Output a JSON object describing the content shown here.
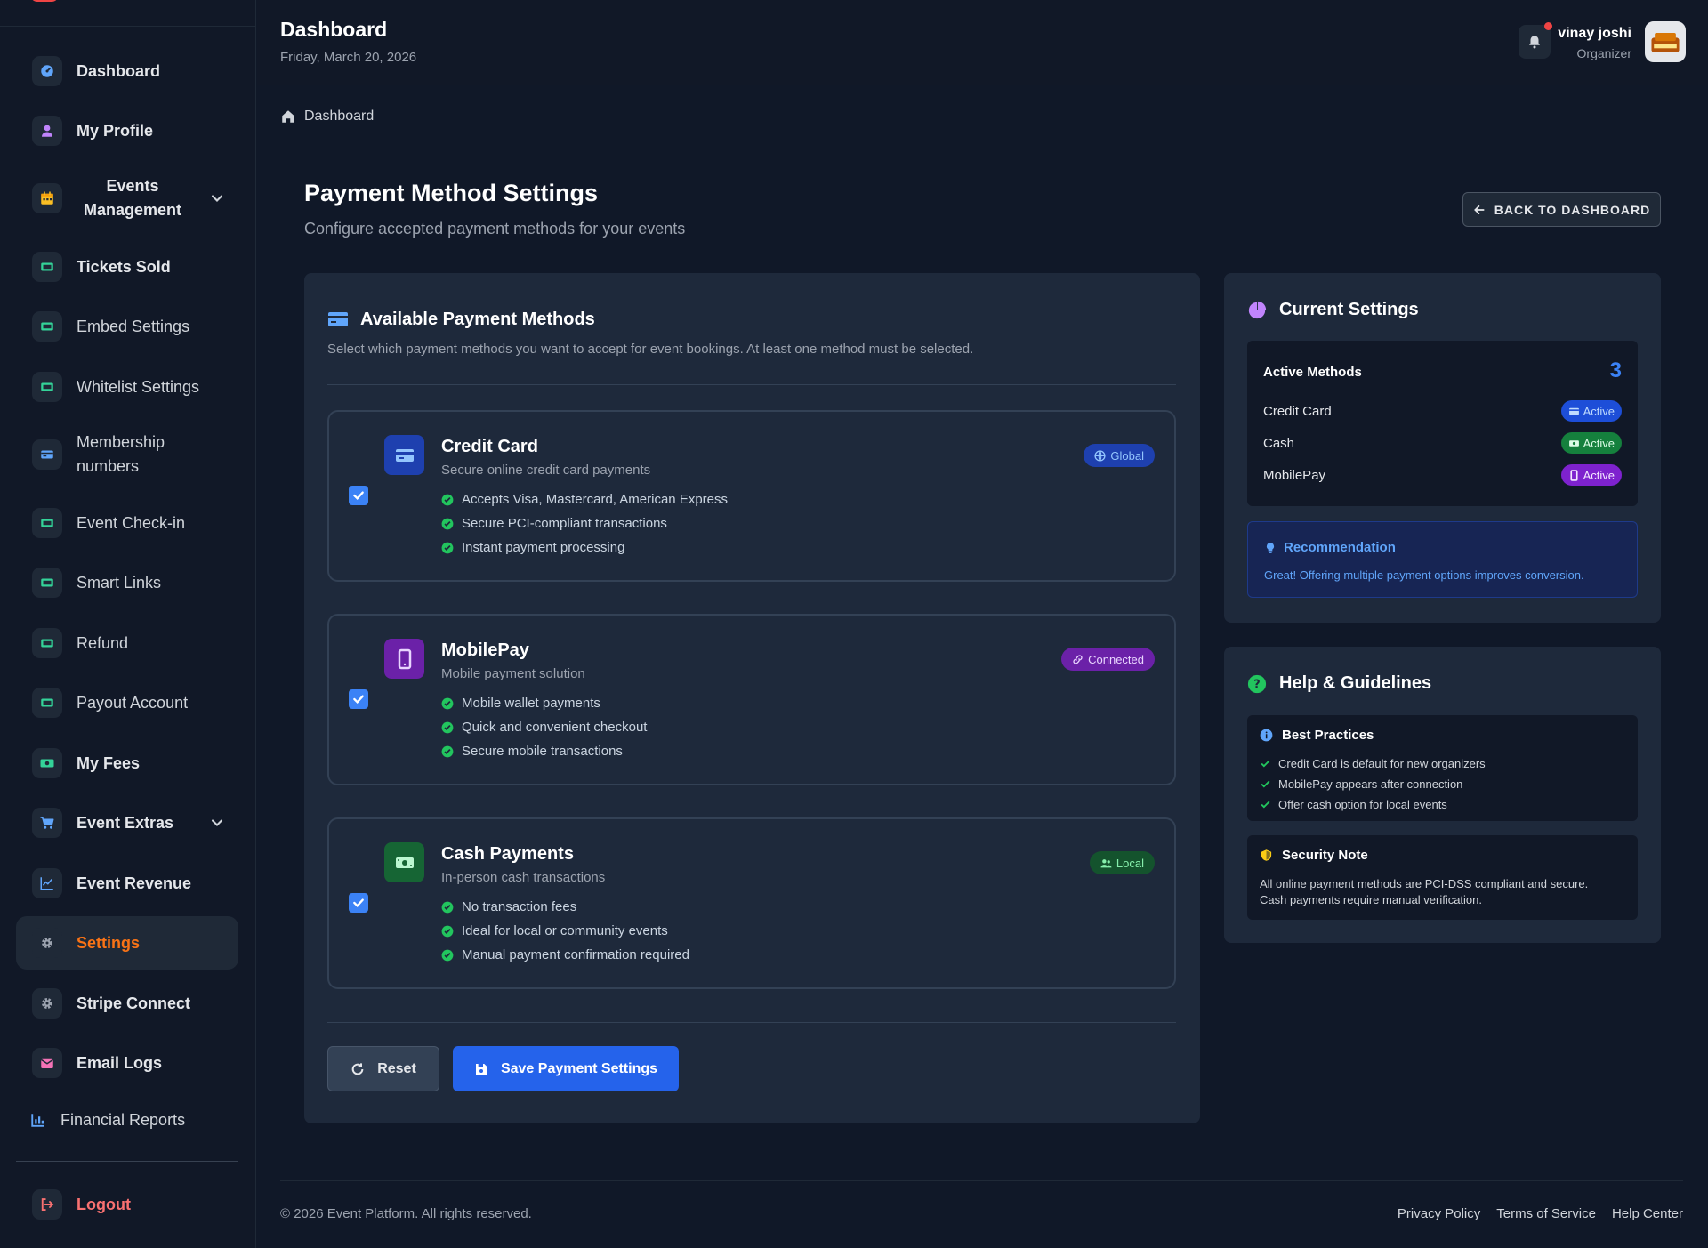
{
  "sidebar": {
    "items": [
      {
        "label": "Dashboard",
        "icon": "dashboard-icon",
        "color": "#60a5fa"
      },
      {
        "label": "My Profile",
        "icon": "user-icon",
        "color": "#c084fc"
      },
      {
        "label": "Events Management",
        "icon": "calendar-icon",
        "color": "#fbbf24"
      },
      {
        "label": "Tickets Sold",
        "icon": "ticket-icon",
        "color": "#34d399"
      },
      {
        "label": "Embed Settings",
        "icon": "ticket-icon",
        "color": "#34d399"
      },
      {
        "label": "Whitelist Settings",
        "icon": "ticket-icon",
        "color": "#34d399"
      },
      {
        "label": "Membership numbers",
        "icon": "card-icon",
        "color": "#60a5fa"
      },
      {
        "label": "Event Check-in",
        "icon": "ticket-icon",
        "color": "#34d399"
      },
      {
        "label": "Smart Links",
        "icon": "ticket-icon",
        "color": "#34d399"
      },
      {
        "label": "Refund",
        "icon": "ticket-icon",
        "color": "#34d399"
      },
      {
        "label": "Payout Account",
        "icon": "ticket-icon",
        "color": "#34d399"
      },
      {
        "label": "My Fees",
        "icon": "money-icon",
        "color": "#34d399"
      },
      {
        "label": "Event Extras",
        "icon": "cart-icon",
        "color": "#60a5fa"
      },
      {
        "label": "Event Revenue",
        "icon": "chart-line-icon",
        "color": "#60a5fa"
      },
      {
        "label": "Settings",
        "icon": "gear-icon",
        "color": "#9ca3af"
      },
      {
        "label": "Stripe Connect",
        "icon": "gear-icon",
        "color": "#9ca3af"
      },
      {
        "label": "Email Logs",
        "icon": "mail-icon",
        "color": "#f472b6"
      },
      {
        "label": "Financial Reports",
        "icon": "bar-chart-icon",
        "color": "#60a5fa"
      },
      {
        "label": "Logout",
        "icon": "logout-icon",
        "color": "#f87171"
      }
    ],
    "active": "Settings"
  },
  "header": {
    "title": "Dashboard",
    "date": "Friday, March 20, 2026",
    "user_name": "vinay joshi",
    "user_role": "Organizer"
  },
  "breadcrumb": {
    "label": "Dashboard"
  },
  "page": {
    "title": "Payment Method Settings",
    "subtitle": "Configure accepted payment methods for your events",
    "back_button": "BACK TO DASHBOARD"
  },
  "methods_card": {
    "title": "Available Payment Methods",
    "description": "Select which payment methods you want to accept for event bookings. At least one method must be selected.",
    "methods": [
      {
        "name": "Credit Card",
        "subtitle": "Secure online credit card payments",
        "badge": "Global",
        "checked": true,
        "features": [
          "Accepts Visa, Mastercard, American Express",
          "Secure PCI-compliant transactions",
          "Instant payment processing"
        ]
      },
      {
        "name": "MobilePay",
        "subtitle": "Mobile payment solution",
        "badge": "Connected",
        "checked": true,
        "features": [
          "Mobile wallet payments",
          "Quick and convenient checkout",
          "Secure mobile transactions"
        ]
      },
      {
        "name": "Cash Payments",
        "subtitle": "In-person cash transactions",
        "badge": "Local",
        "checked": true,
        "features": [
          "No transaction fees",
          "Ideal for local or community events",
          "Manual payment confirmation required"
        ]
      }
    ],
    "reset_label": "Reset",
    "save_label": "Save Payment Settings"
  },
  "current_settings": {
    "title": "Current Settings",
    "active_label": "Active Methods",
    "active_count": "3",
    "rows": [
      {
        "name": "Credit Card",
        "status": "Active"
      },
      {
        "name": "Cash",
        "status": "Active"
      },
      {
        "name": "MobilePay",
        "status": "Active"
      }
    ],
    "recommendation_title": "Recommendation",
    "recommendation_text": "Great! Offering multiple payment options improves conversion."
  },
  "help": {
    "title": "Help & Guidelines",
    "best_title": "Best Practices",
    "best_items": [
      "Credit Card is default for new organizers",
      "MobilePay appears after connection",
      "Offer cash option for local events"
    ],
    "security_title": "Security Note",
    "security_lines": [
      "All online payment methods are PCI-DSS compliant and secure.",
      "Cash payments require manual verification."
    ]
  },
  "footer": {
    "copyright": "© 2026 Event Platform. All rights reserved.",
    "links": [
      "Privacy Policy",
      "Terms of Service",
      "Help Center"
    ]
  },
  "colors": {
    "accent": "#2563eb",
    "active_nav": "#f97316",
    "success": "#22c55e",
    "background": "#101828"
  }
}
